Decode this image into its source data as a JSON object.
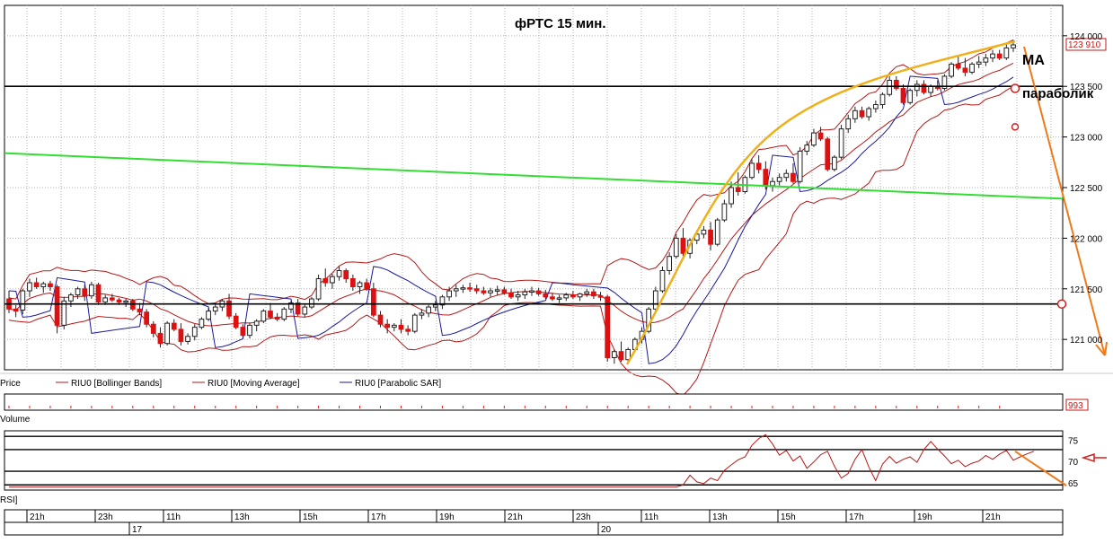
{
  "chart_data": {
    "type": "candlestick",
    "title": "фРТС   15 мин.",
    "y_ticks": [
      124000,
      123500,
      123000,
      122500,
      122000,
      121500,
      121000
    ],
    "y_tick_labels": [
      "124 000",
      "123 500",
      "123 000",
      "122 500",
      "122 000",
      "121 500",
      "121 000"
    ],
    "ylim": [
      120700,
      124300
    ],
    "last_price_label": "123 910",
    "candles": [
      [
        121400,
        121480,
        121260,
        121300
      ],
      [
        121300,
        121340,
        121220,
        121280
      ],
      [
        121290,
        121500,
        121250,
        121480
      ],
      [
        121480,
        121600,
        121420,
        121560
      ],
      [
        121560,
        121610,
        121500,
        121520
      ],
      [
        121520,
        121570,
        121460,
        121550
      ],
      [
        121550,
        121580,
        121480,
        121520
      ],
      [
        121520,
        121540,
        121060,
        121140
      ],
      [
        121140,
        121420,
        121100,
        121380
      ],
      [
        121380,
        121460,
        121320,
        121440
      ],
      [
        121440,
        121520,
        121400,
        121500
      ],
      [
        121500,
        121540,
        121380,
        121430
      ],
      [
        121430,
        121570,
        121400,
        121540
      ],
      [
        121540,
        121560,
        121340,
        121370
      ],
      [
        121370,
        121440,
        121340,
        121410
      ],
      [
        121410,
        121450,
        121370,
        121390
      ],
      [
        121390,
        121410,
        121340,
        121370
      ],
      [
        121370,
        121400,
        121320,
        121380
      ],
      [
        121380,
        121400,
        121280,
        121300
      ],
      [
        121300,
        121360,
        121240,
        121270
      ],
      [
        121270,
        121300,
        121120,
        121150
      ],
      [
        121150,
        121180,
        121020,
        121060
      ],
      [
        121060,
        121120,
        120920,
        120960
      ],
      [
        120960,
        121180,
        120940,
        121160
      ],
      [
        121160,
        121200,
        121080,
        121100
      ],
      [
        121100,
        121160,
        120940,
        120980
      ],
      [
        120980,
        121060,
        120950,
        121030
      ],
      [
        121030,
        121150,
        120990,
        121120
      ],
      [
        121120,
        121220,
        121100,
        121200
      ],
      [
        121200,
        121310,
        121180,
        121280
      ],
      [
        121280,
        121360,
        121240,
        121320
      ],
      [
        121320,
        121400,
        121280,
        121380
      ],
      [
        121380,
        121450,
        121200,
        121230
      ],
      [
        121230,
        121260,
        121100,
        121120
      ],
      [
        121120,
        121150,
        121020,
        121040
      ],
      [
        121040,
        121160,
        121010,
        121140
      ],
      [
        121140,
        121200,
        121080,
        121180
      ],
      [
        121180,
        121300,
        121160,
        121280
      ],
      [
        121280,
        121360,
        121200,
        121220
      ],
      [
        121220,
        121260,
        121180,
        121200
      ],
      [
        121200,
        121320,
        121180,
        121300
      ],
      [
        121300,
        121380,
        121260,
        121360
      ],
      [
        121360,
        121400,
        121230,
        121250
      ],
      [
        121250,
        121350,
        121220,
        121320
      ],
      [
        121320,
        121420,
        121300,
        121400
      ],
      [
        121400,
        121640,
        121380,
        121600
      ],
      [
        121600,
        121700,
        121520,
        121560
      ],
      [
        121560,
        121650,
        121500,
        121620
      ],
      [
        121620,
        121720,
        121580,
        121680
      ],
      [
        121680,
        121700,
        121560,
        121600
      ],
      [
        121600,
        121640,
        121480,
        121520
      ],
      [
        121520,
        121580,
        121450,
        121560
      ],
      [
        121560,
        121600,
        121480,
        121500
      ],
      [
        121500,
        121560,
        121220,
        121240
      ],
      [
        121240,
        121280,
        121120,
        121150
      ],
      [
        121150,
        121200,
        121060,
        121120
      ],
      [
        121120,
        121160,
        121080,
        121140
      ],
      [
        121140,
        121200,
        121060,
        121100
      ],
      [
        121100,
        121140,
        121040,
        121080
      ],
      [
        121080,
        121260,
        121060,
        121240
      ],
      [
        121240,
        121300,
        121200,
        121260
      ],
      [
        121260,
        121340,
        121220,
        121320
      ],
      [
        121320,
        121380,
        121280,
        121340
      ],
      [
        121340,
        121440,
        121300,
        121420
      ],
      [
        121420,
        121520,
        121380,
        121480
      ],
      [
        121480,
        121540,
        121420,
        121500
      ],
      [
        121500,
        121540,
        121460,
        121510
      ],
      [
        121510,
        121560,
        121470,
        121500
      ],
      [
        121500,
        121540,
        121450,
        121480
      ],
      [
        121480,
        121520,
        121440,
        121460
      ],
      [
        121460,
        121510,
        121420,
        121480
      ],
      [
        121480,
        121530,
        121440,
        121490
      ],
      [
        121490,
        121520,
        121440,
        121460
      ],
      [
        121460,
        121500,
        121400,
        121420
      ],
      [
        121420,
        121480,
        121380,
        121440
      ],
      [
        121440,
        121500,
        121400,
        121470
      ],
      [
        121470,
        121520,
        121430,
        121480
      ],
      [
        121480,
        121510,
        121430,
        121450
      ],
      [
        121450,
        121490,
        121400,
        121420
      ],
      [
        121420,
        121460,
        121380,
        121400
      ],
      [
        121400,
        121440,
        121360,
        121410
      ],
      [
        121410,
        121460,
        121380,
        121440
      ],
      [
        121440,
        121480,
        121400,
        121420
      ],
      [
        121420,
        121460,
        121380,
        121450
      ],
      [
        121450,
        121500,
        121420,
        121470
      ],
      [
        121470,
        121500,
        121400,
        121430
      ],
      [
        121430,
        121470,
        121380,
        121420
      ],
      [
        121420,
        121440,
        120780,
        120820
      ],
      [
        120820,
        120900,
        120760,
        120880
      ],
      [
        120880,
        120980,
        120780,
        120800
      ],
      [
        120800,
        120920,
        120780,
        120900
      ],
      [
        120900,
        121020,
        120880,
        121000
      ],
      [
        121000,
        121120,
        120960,
        121080
      ],
      [
        121080,
        121320,
        121060,
        121300
      ],
      [
        121300,
        121520,
        121280,
        121480
      ],
      [
        121480,
        121720,
        121460,
        121680
      ],
      [
        121680,
        121860,
        121640,
        121820
      ],
      [
        121820,
        122040,
        121800,
        122000
      ],
      [
        122000,
        122100,
        121800,
        121850
      ],
      [
        121850,
        122000,
        121800,
        121980
      ],
      [
        121980,
        122080,
        121940,
        122040
      ],
      [
        122040,
        122120,
        122000,
        122080
      ],
      [
        122080,
        122160,
        121880,
        121940
      ],
      [
        121940,
        122200,
        121920,
        122180
      ],
      [
        122180,
        122380,
        122160,
        122340
      ],
      [
        122340,
        122560,
        122300,
        122500
      ],
      [
        122500,
        122650,
        122420,
        122460
      ],
      [
        122460,
        122620,
        122440,
        122600
      ],
      [
        122600,
        122780,
        122580,
        122740
      ],
      [
        122740,
        122820,
        122640,
        122680
      ],
      [
        122680,
        122760,
        122480,
        122520
      ],
      [
        122520,
        122600,
        122460,
        122560
      ],
      [
        122560,
        122640,
        122520,
        122600
      ],
      [
        122600,
        122680,
        122560,
        122640
      ],
      [
        122640,
        122740,
        122540,
        122560
      ],
      [
        122560,
        122900,
        122540,
        122860
      ],
      [
        122860,
        122960,
        122820,
        122920
      ],
      [
        122920,
        123080,
        122900,
        123040
      ],
      [
        123040,
        123100,
        122960,
        122980
      ],
      [
        122980,
        123000,
        122660,
        122680
      ],
      [
        122680,
        122820,
        122660,
        122800
      ],
      [
        122800,
        123120,
        122780,
        123080
      ],
      [
        123080,
        123220,
        123040,
        123180
      ],
      [
        123180,
        123300,
        123140,
        123260
      ],
      [
        123260,
        123300,
        123180,
        123200
      ],
      [
        123200,
        123300,
        123160,
        123280
      ],
      [
        123280,
        123360,
        123240,
        123320
      ],
      [
        123320,
        123440,
        123280,
        123420
      ],
      [
        123420,
        123600,
        123400,
        123560
      ],
      [
        123560,
        123600,
        123460,
        123480
      ],
      [
        123480,
        123520,
        123320,
        123340
      ],
      [
        123340,
        123480,
        123320,
        123460
      ],
      [
        123460,
        123560,
        123400,
        123520
      ],
      [
        123520,
        123560,
        123420,
        123440
      ],
      [
        123440,
        123520,
        123400,
        123500
      ],
      [
        123500,
        123560,
        123460,
        123480
      ],
      [
        123480,
        123620,
        123460,
        123600
      ],
      [
        123600,
        123740,
        123580,
        123720
      ],
      [
        123720,
        123800,
        123660,
        123680
      ],
      [
        123680,
        123780,
        123600,
        123640
      ],
      [
        123640,
        123740,
        123620,
        123720
      ],
      [
        123720,
        123800,
        123680,
        123740
      ],
      [
        123740,
        123820,
        123700,
        123780
      ],
      [
        123780,
        123860,
        123740,
        123820
      ],
      [
        123820,
        123860,
        123760,
        123780
      ],
      [
        123780,
        123920,
        123760,
        123880
      ],
      [
        123880,
        123960,
        123840,
        123910
      ]
    ],
    "legend": [
      "Price",
      "RIU0 [Bollinger Bands]",
      "RIU0 [Moving Average]",
      "RIU0 [Parabolic SAR]"
    ],
    "volume_label": "Volume",
    "volume_value_label": "993",
    "rsi": {
      "label": "RSI]",
      "ticks": [
        75,
        70,
        65
      ],
      "ylim": [
        63.5,
        77
      ],
      "values": [
        64,
        64,
        64,
        64,
        64,
        64,
        64,
        64,
        64,
        64,
        64,
        64,
        64,
        64,
        64,
        64,
        64,
        64,
        64,
        64,
        64,
        64,
        64,
        64,
        64,
        64,
        64,
        64,
        64,
        64,
        64,
        64,
        64,
        64,
        64,
        64,
        64,
        64,
        64,
        64,
        64,
        64,
        64,
        64,
        64,
        64,
        64,
        64,
        64,
        64,
        64,
        64,
        64,
        64,
        64,
        64,
        64,
        64,
        64,
        64,
        64,
        64,
        64,
        64,
        64,
        64,
        64,
        64,
        64,
        64,
        64,
        64,
        64,
        64,
        64,
        64,
        64,
        64,
        64,
        64,
        64,
        64,
        64,
        64,
        64,
        64,
        64,
        64,
        64,
        64,
        64,
        64,
        64,
        64,
        64,
        64,
        64,
        64,
        64.5,
        66.8,
        65.2,
        64.8,
        66.1,
        65.5,
        67.9,
        69.2,
        70.4,
        71.1,
        73.8,
        75.4,
        76.3,
        74.1,
        71.5,
        72.6,
        70.1,
        71.3,
        68.4,
        69.9,
        71.6,
        72.4,
        68.9,
        66.1,
        67.2,
        70.5,
        72.8,
        68.7,
        65.5,
        69.4,
        71.2,
        69.6,
        70.5,
        71.1,
        69.8,
        72.8,
        74.7,
        72.9,
        71.3,
        69.5,
        70.3,
        68.8,
        69.6,
        70.1,
        71.4,
        70.5,
        71.7,
        72.6,
        70.3,
        71.1,
        71.8,
        72.4
      ]
    },
    "time_labels": [
      "21h",
      "23h",
      "11h",
      "13h",
      "15h",
      "17h",
      "19h",
      "21h",
      "23h",
      "11h",
      "13h",
      "15h",
      "17h",
      "19h",
      "21h"
    ],
    "date_labels": [
      "17",
      "20"
    ],
    "annotations": [
      "МА",
      "параболик"
    ],
    "horizontal_lines": [
      123500,
      121350
    ],
    "colors": {
      "bull": "#ffffff",
      "bear": "#dd1111",
      "band": "#b41818",
      "sar": "#1a1a9a",
      "trend": "#33dd33",
      "annot": "#f0b01a",
      "arrow": "#ee7a1a"
    }
  }
}
